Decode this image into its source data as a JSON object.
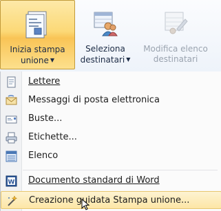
{
  "ribbon": {
    "start_merge": {
      "label_line1": "Inizia stampa",
      "label_line2": "unione",
      "icon": "document-merge-icon"
    },
    "select_recipients": {
      "label_line1": "Seleziona",
      "label_line2": "destinatari",
      "icon": "recipients-icon"
    },
    "edit_list": {
      "label_line1": "Modifica elenco",
      "label_line2": "destinatari",
      "icon": "edit-list-icon"
    },
    "colors": {
      "active_bg": "#fcd977",
      "disabled_text": "#9aa3af"
    }
  },
  "menu": {
    "items": [
      {
        "label": "Lettere",
        "icon": "letter-icon"
      },
      {
        "label": "Messaggi di posta elettronica",
        "icon": "envelope-mail-icon"
      },
      {
        "label": "Buste...",
        "icon": "envelope-icon"
      },
      {
        "label": "Etichette...",
        "icon": "labels-printer-icon"
      },
      {
        "label": "Elenco",
        "icon": "directory-list-icon"
      },
      {
        "label": "Documento standard di Word",
        "icon": "word-icon"
      },
      {
        "label": "Creazione guidata Stampa unione...",
        "icon": "wizard-icon"
      }
    ]
  }
}
